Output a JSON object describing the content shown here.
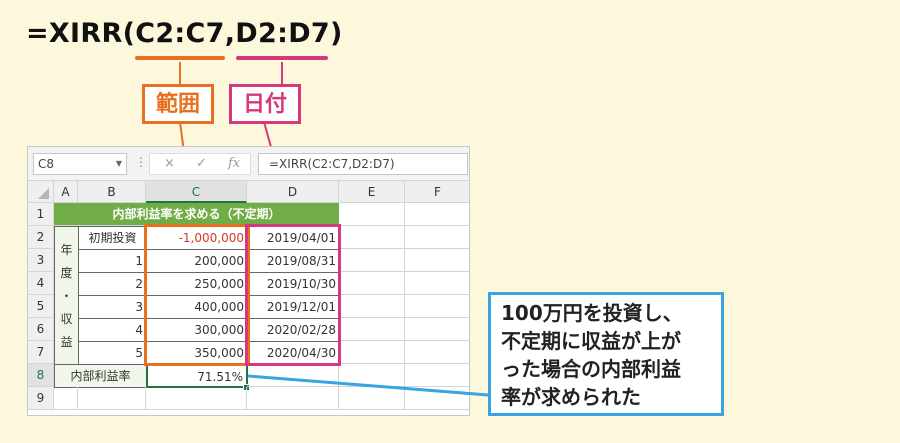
{
  "formula": {
    "text_prefix": "=XIRR(",
    "arg1": "C2:C7",
    "comma": ",",
    "arg2": "D2:D7",
    "text_suffix": ")"
  },
  "callouts": {
    "range_label": "範囲",
    "date_label": "日付"
  },
  "colors": {
    "orange": "#e8701e",
    "magenta": "#d6387c",
    "blue": "#3aa3e2",
    "green": "#71ad47",
    "red": "#d6392b"
  },
  "formula_bar": {
    "name_box": "C8",
    "cancel_icon": "×",
    "enter_icon": "✓",
    "fx_icon": "fx",
    "formula": "=XIRR(C2:C7,D2:D7)"
  },
  "sheet": {
    "columns": [
      "A",
      "B",
      "C",
      "D",
      "E",
      "F"
    ],
    "rows": [
      "1",
      "2",
      "3",
      "4",
      "5",
      "6",
      "7",
      "8",
      "9"
    ],
    "title": "内部利益率を求める（不定期）",
    "side_label": [
      "年",
      "度",
      "・",
      "収",
      "益"
    ],
    "data": [
      {
        "b": "初期投資",
        "c": "-1,000,000",
        "d": "2019/04/01"
      },
      {
        "b": "1",
        "c": "200,000",
        "d": "2019/08/31"
      },
      {
        "b": "2",
        "c": "250,000",
        "d": "2019/10/30"
      },
      {
        "b": "3",
        "c": "400,000",
        "d": "2019/12/01"
      },
      {
        "b": "4",
        "c": "300,000",
        "d": "2020/02/28"
      },
      {
        "b": "5",
        "c": "350,000",
        "d": "2020/04/30"
      }
    ],
    "result_label": "内部利益率",
    "result_value": "71.51%"
  },
  "note": {
    "lines": [
      "100万円を投資し、",
      "不定期に収益が上が",
      "った場合の内部利益",
      "率が求められた"
    ]
  }
}
